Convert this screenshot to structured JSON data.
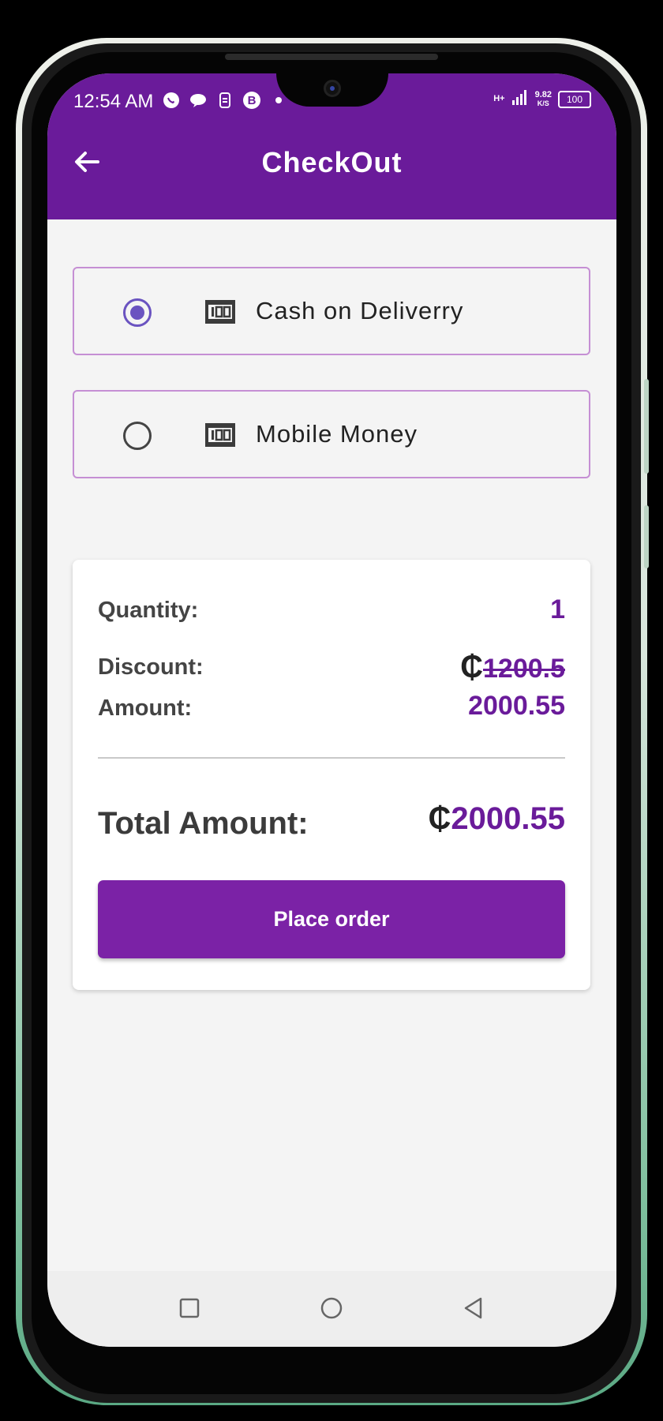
{
  "status_bar": {
    "time": "12:54 AM",
    "net_type": "H+",
    "speed_value": "9.82",
    "speed_unit": "K/S",
    "battery": "100",
    "icons": [
      "whatsapp-icon",
      "chat-bubble-icon",
      "sim-icon",
      "b-app-icon",
      "dot-icon",
      "signal-icon"
    ]
  },
  "header": {
    "title": "CheckOut",
    "back_icon": "arrow-back-icon"
  },
  "payment_options": [
    {
      "label": "Cash on Deliverry",
      "selected": true,
      "icon": "money-icon"
    },
    {
      "label": "Mobile Money",
      "selected": false,
      "icon": "money-icon"
    }
  ],
  "summary": {
    "quantity_label": "Quantity:",
    "quantity_value": "1",
    "discount_label": "Discount:",
    "currency_symbol": "₵",
    "discount_value": "1200.5",
    "amount_label": "Amount:",
    "amount_value": "2000.55",
    "total_label": "Total Amount:",
    "total_value": "2000.55"
  },
  "actions": {
    "place_order_label": "Place order"
  },
  "nav_bar": {
    "items": [
      "recents-square-icon",
      "home-circle-icon",
      "back-triangle-icon"
    ]
  },
  "colors": {
    "primary": "#6a1b9a",
    "button": "#7b22a6",
    "radio_selected": "#6a53c0",
    "option_border": "#c58fd4",
    "background": "#f4f4f4"
  }
}
